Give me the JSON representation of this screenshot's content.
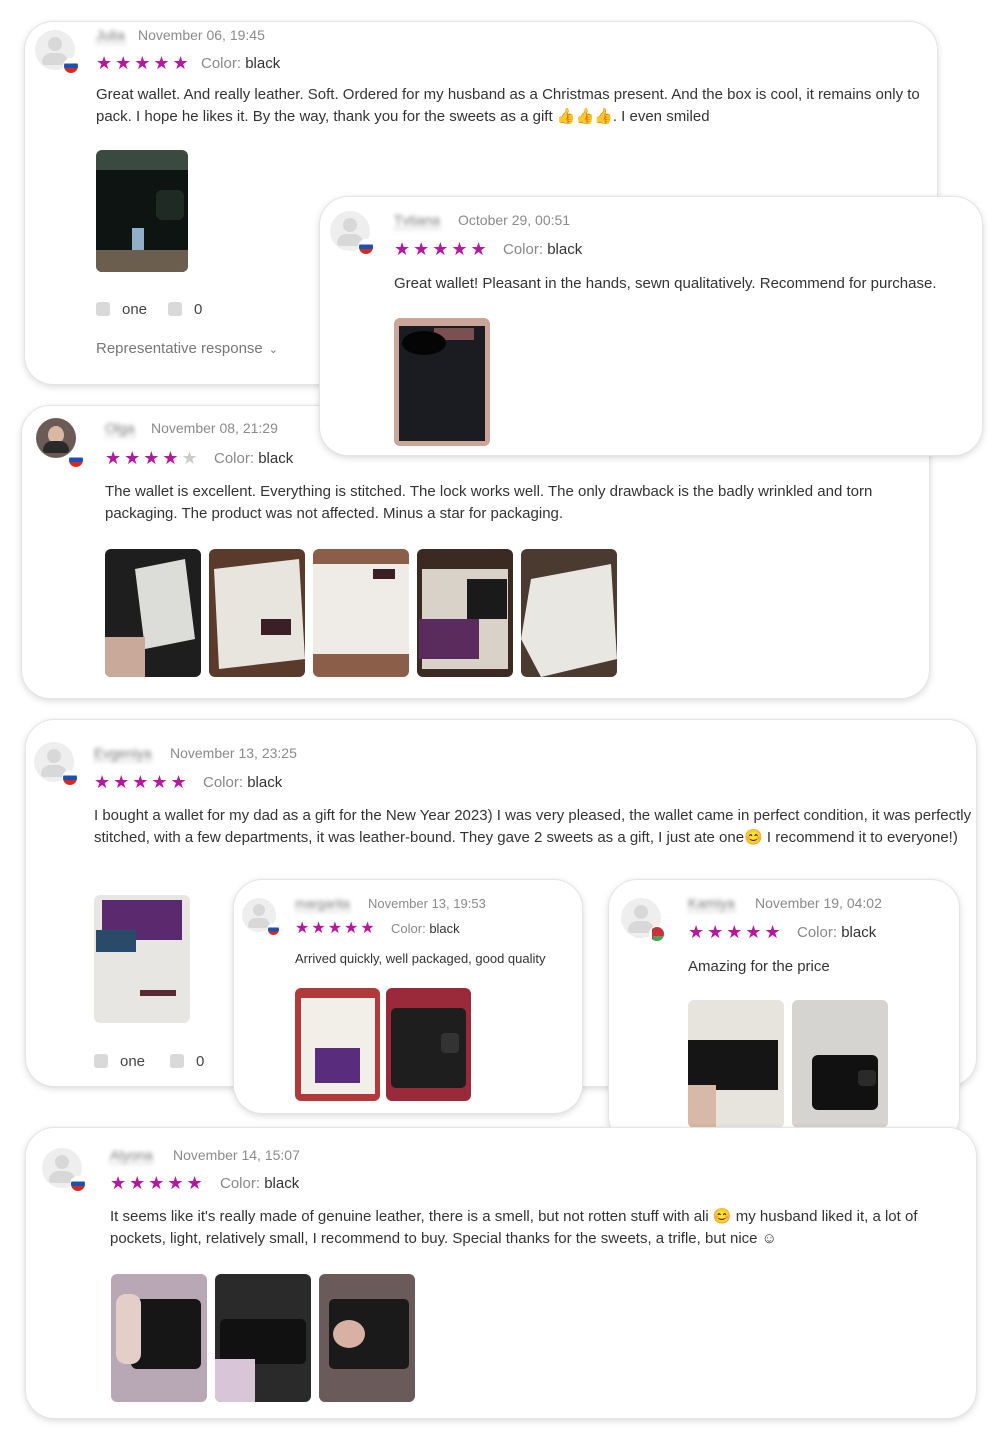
{
  "reviews": [
    {
      "name": "Julia",
      "date": "November 06, 19:45",
      "stars": "★★★★★",
      "color_label": "Color:",
      "color_value": "black",
      "text": "Great wallet. And really leather. Soft. Ordered for my husband as a Christmas present. And the box is cool, it remains only to pack. I hope he likes it. By the way, thank you for the sweets as a gift 👍👍👍. I even smiled",
      "likes": "one",
      "dislikes": "0",
      "representative_response": "Representative response"
    },
    {
      "name": "Tvtiana",
      "date": "October 29, 00:51",
      "stars": "★★★★★",
      "color_label": "Color:",
      "color_value": "black",
      "text": "Great wallet! Pleasant in the hands, sewn qualitatively. Recommend for purchase."
    },
    {
      "name": "Olga",
      "date": "November 08, 21:29",
      "stars": "★★★★",
      "stars_empty": "★",
      "color_label": "Color:",
      "color_value": "black",
      "text": "The wallet is excellent. Everything is stitched. The lock works well. The only drawback is the badly wrinkled and torn packaging. The product was not affected. Minus a star for packaging."
    },
    {
      "name": "Evgeniya",
      "date": "November 13, 23:25",
      "stars": "★★★★★",
      "color_label": "Color:",
      "color_value": "black",
      "text": "I bought a wallet for my dad as a gift for the New Year 2023) I was very pleased, the wallet came in perfect condition, it was perfectly stitched, with a few departments, it was leather-bound. They gave 2 sweets as a gift, I just ate one😊 I recommend it to everyone!)",
      "likes": "one",
      "dislikes": "0"
    },
    {
      "name": "margarita",
      "date": "November 13, 19:53",
      "stars": "★★★★★",
      "color_label": "Color:",
      "color_value": "black",
      "text": "Arrived quickly, well packaged, good quality"
    },
    {
      "name": "Kamiya",
      "date": "November 19, 04:02",
      "stars": "★★★★★",
      "color_label": "Color:",
      "color_value": "black",
      "text": "Amazing for the price"
    },
    {
      "name": "Alyona",
      "date": "November 14, 15:07",
      "stars": "★★★★★",
      "color_label": "Color:",
      "color_value": "black",
      "text": "It seems like it's really made of genuine leather, there is a smell, but not rotten stuff with ali 😊 my husband liked it, a lot of pockets, light, relatively small, I recommend to buy. Special thanks for the sweets, a trifle, but nice ☺"
    }
  ],
  "icons": {
    "like": "thumbs-up-icon",
    "dislike": "thumbs-down-icon",
    "chevron": "chevron-down-icon"
  },
  "colors": {
    "star": "#b5179e",
    "star_empty": "#cccccc"
  }
}
